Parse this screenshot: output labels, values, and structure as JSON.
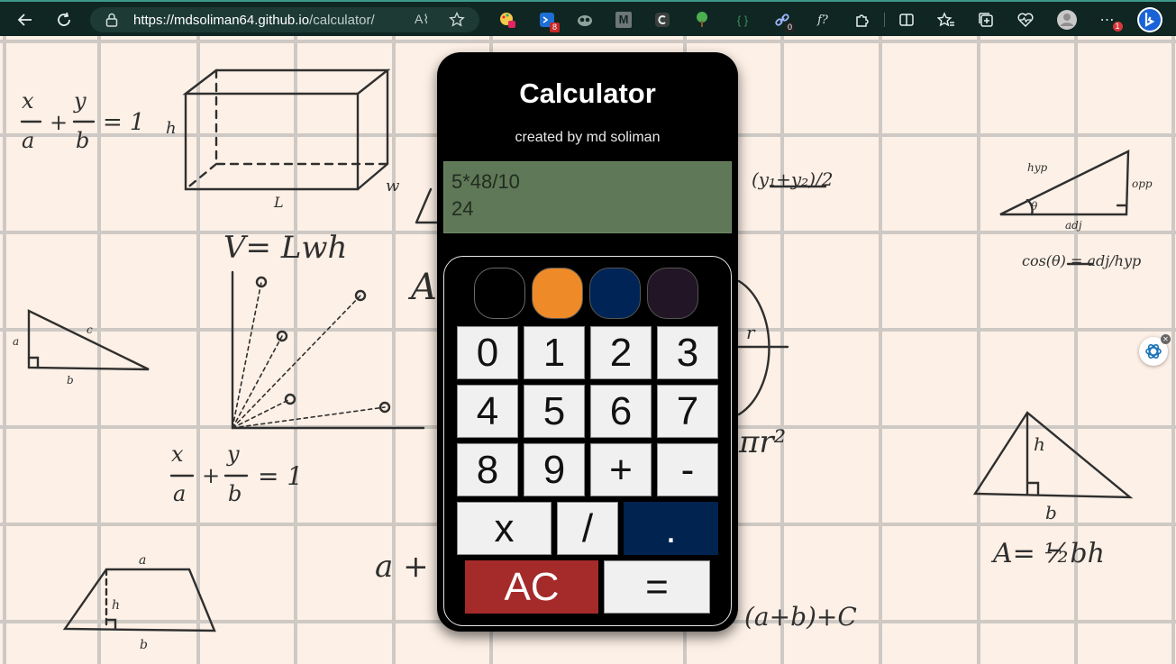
{
  "browser": {
    "url_host": "https://mdsoliman64.github.io",
    "url_path": "/calculator/",
    "reader_label": "A⌇",
    "ext_badges": {
      "dev": "8",
      "link": "0",
      "menu": "1"
    },
    "ext_glyphs": {
      "m": "M",
      "braces": "{ }",
      "fx": "f?",
      "more": "⋯"
    },
    "colors": {
      "toolbar": "#0f2622",
      "address_bar": "#1e3a35",
      "accent_line": "#3d9a8a"
    }
  },
  "background_doodles": {
    "eq1": "x/a + y/b = 1",
    "eq2": "V= Lwh",
    "eq3": "x/a + y/b = 1",
    "circle_r": "r",
    "eq4": "πr²",
    "eq5": "(a+b)+C",
    "eq6": "a +",
    "midpoint": "(y₁+y₂)/2",
    "cos": "cos(θ) = adj/hyp",
    "tri_area": "A= ½bh",
    "labels": {
      "h": "h",
      "w": "w",
      "l": "L",
      "a": "a",
      "b": "b",
      "c": "c",
      "hyp": "hyp",
      "opp": "opp",
      "adj": "adj",
      "theta": "θ",
      "big_a": "A"
    }
  },
  "calculator": {
    "title": "Calculator",
    "subtitle": "created by md soliman",
    "display": {
      "expression": "5*48/10",
      "result": "24"
    },
    "themes": [
      {
        "name": "black-theme",
        "color": "#000000"
      },
      {
        "name": "orange-theme",
        "color": "#ee8a28"
      },
      {
        "name": "navy-theme",
        "color": "#002456"
      },
      {
        "name": "dark-purple-theme",
        "color": "#221525"
      }
    ],
    "keys": {
      "k0": "0",
      "k1": "1",
      "k2": "2",
      "k3": "3",
      "k4": "4",
      "k5": "5",
      "k6": "6",
      "k7": "7",
      "k8": "8",
      "k9": "9",
      "plus": "+",
      "minus": "-",
      "multiply": "x",
      "divide": "/",
      "dot": ".",
      "clear": "AC",
      "equals": "="
    },
    "colors": {
      "dot_key": "#00234f",
      "ac_key": "#a52a2a",
      "display": "#5f7857"
    }
  }
}
